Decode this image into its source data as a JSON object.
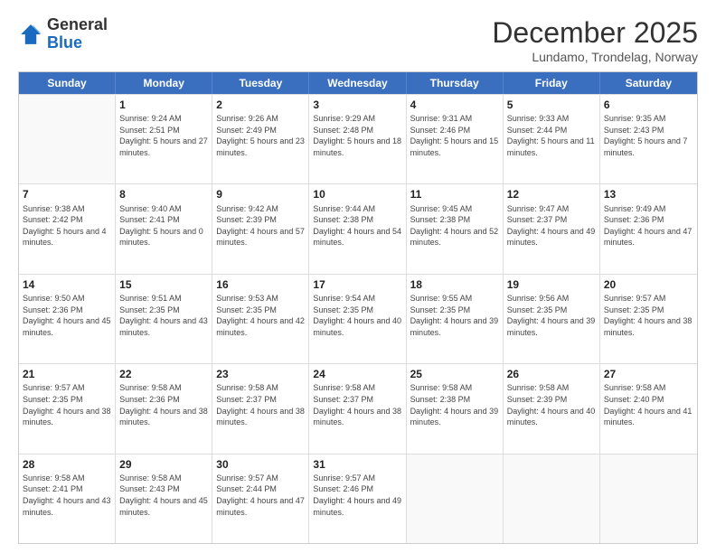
{
  "header": {
    "logo": {
      "line1": "General",
      "line2": "Blue"
    },
    "month": "December 2025",
    "location": "Lundamo, Trondelag, Norway"
  },
  "weekdays": [
    "Sunday",
    "Monday",
    "Tuesday",
    "Wednesday",
    "Thursday",
    "Friday",
    "Saturday"
  ],
  "rows": [
    [
      {
        "day": "",
        "empty": true
      },
      {
        "day": "1",
        "sunrise": "Sunrise: 9:24 AM",
        "sunset": "Sunset: 2:51 PM",
        "daylight": "Daylight: 5 hours and 27 minutes."
      },
      {
        "day": "2",
        "sunrise": "Sunrise: 9:26 AM",
        "sunset": "Sunset: 2:49 PM",
        "daylight": "Daylight: 5 hours and 23 minutes."
      },
      {
        "day": "3",
        "sunrise": "Sunrise: 9:29 AM",
        "sunset": "Sunset: 2:48 PM",
        "daylight": "Daylight: 5 hours and 18 minutes."
      },
      {
        "day": "4",
        "sunrise": "Sunrise: 9:31 AM",
        "sunset": "Sunset: 2:46 PM",
        "daylight": "Daylight: 5 hours and 15 minutes."
      },
      {
        "day": "5",
        "sunrise": "Sunrise: 9:33 AM",
        "sunset": "Sunset: 2:44 PM",
        "daylight": "Daylight: 5 hours and 11 minutes."
      },
      {
        "day": "6",
        "sunrise": "Sunrise: 9:35 AM",
        "sunset": "Sunset: 2:43 PM",
        "daylight": "Daylight: 5 hours and 7 minutes."
      }
    ],
    [
      {
        "day": "7",
        "sunrise": "Sunrise: 9:38 AM",
        "sunset": "Sunset: 2:42 PM",
        "daylight": "Daylight: 5 hours and 4 minutes."
      },
      {
        "day": "8",
        "sunrise": "Sunrise: 9:40 AM",
        "sunset": "Sunset: 2:41 PM",
        "daylight": "Daylight: 5 hours and 0 minutes."
      },
      {
        "day": "9",
        "sunrise": "Sunrise: 9:42 AM",
        "sunset": "Sunset: 2:39 PM",
        "daylight": "Daylight: 4 hours and 57 minutes."
      },
      {
        "day": "10",
        "sunrise": "Sunrise: 9:44 AM",
        "sunset": "Sunset: 2:38 PM",
        "daylight": "Daylight: 4 hours and 54 minutes."
      },
      {
        "day": "11",
        "sunrise": "Sunrise: 9:45 AM",
        "sunset": "Sunset: 2:38 PM",
        "daylight": "Daylight: 4 hours and 52 minutes."
      },
      {
        "day": "12",
        "sunrise": "Sunrise: 9:47 AM",
        "sunset": "Sunset: 2:37 PM",
        "daylight": "Daylight: 4 hours and 49 minutes."
      },
      {
        "day": "13",
        "sunrise": "Sunrise: 9:49 AM",
        "sunset": "Sunset: 2:36 PM",
        "daylight": "Daylight: 4 hours and 47 minutes."
      }
    ],
    [
      {
        "day": "14",
        "sunrise": "Sunrise: 9:50 AM",
        "sunset": "Sunset: 2:36 PM",
        "daylight": "Daylight: 4 hours and 45 minutes."
      },
      {
        "day": "15",
        "sunrise": "Sunrise: 9:51 AM",
        "sunset": "Sunset: 2:35 PM",
        "daylight": "Daylight: 4 hours and 43 minutes."
      },
      {
        "day": "16",
        "sunrise": "Sunrise: 9:53 AM",
        "sunset": "Sunset: 2:35 PM",
        "daylight": "Daylight: 4 hours and 42 minutes."
      },
      {
        "day": "17",
        "sunrise": "Sunrise: 9:54 AM",
        "sunset": "Sunset: 2:35 PM",
        "daylight": "Daylight: 4 hours and 40 minutes."
      },
      {
        "day": "18",
        "sunrise": "Sunrise: 9:55 AM",
        "sunset": "Sunset: 2:35 PM",
        "daylight": "Daylight: 4 hours and 39 minutes."
      },
      {
        "day": "19",
        "sunrise": "Sunrise: 9:56 AM",
        "sunset": "Sunset: 2:35 PM",
        "daylight": "Daylight: 4 hours and 39 minutes."
      },
      {
        "day": "20",
        "sunrise": "Sunrise: 9:57 AM",
        "sunset": "Sunset: 2:35 PM",
        "daylight": "Daylight: 4 hours and 38 minutes."
      }
    ],
    [
      {
        "day": "21",
        "sunrise": "Sunrise: 9:57 AM",
        "sunset": "Sunset: 2:35 PM",
        "daylight": "Daylight: 4 hours and 38 minutes."
      },
      {
        "day": "22",
        "sunrise": "Sunrise: 9:58 AM",
        "sunset": "Sunset: 2:36 PM",
        "daylight": "Daylight: 4 hours and 38 minutes."
      },
      {
        "day": "23",
        "sunrise": "Sunrise: 9:58 AM",
        "sunset": "Sunset: 2:37 PM",
        "daylight": "Daylight: 4 hours and 38 minutes."
      },
      {
        "day": "24",
        "sunrise": "Sunrise: 9:58 AM",
        "sunset": "Sunset: 2:37 PM",
        "daylight": "Daylight: 4 hours and 38 minutes."
      },
      {
        "day": "25",
        "sunrise": "Sunrise: 9:58 AM",
        "sunset": "Sunset: 2:38 PM",
        "daylight": "Daylight: 4 hours and 39 minutes."
      },
      {
        "day": "26",
        "sunrise": "Sunrise: 9:58 AM",
        "sunset": "Sunset: 2:39 PM",
        "daylight": "Daylight: 4 hours and 40 minutes."
      },
      {
        "day": "27",
        "sunrise": "Sunrise: 9:58 AM",
        "sunset": "Sunset: 2:40 PM",
        "daylight": "Daylight: 4 hours and 41 minutes."
      }
    ],
    [
      {
        "day": "28",
        "sunrise": "Sunrise: 9:58 AM",
        "sunset": "Sunset: 2:41 PM",
        "daylight": "Daylight: 4 hours and 43 minutes."
      },
      {
        "day": "29",
        "sunrise": "Sunrise: 9:58 AM",
        "sunset": "Sunset: 2:43 PM",
        "daylight": "Daylight: 4 hours and 45 minutes."
      },
      {
        "day": "30",
        "sunrise": "Sunrise: 9:57 AM",
        "sunset": "Sunset: 2:44 PM",
        "daylight": "Daylight: 4 hours and 47 minutes."
      },
      {
        "day": "31",
        "sunrise": "Sunrise: 9:57 AM",
        "sunset": "Sunset: 2:46 PM",
        "daylight": "Daylight: 4 hours and 49 minutes."
      },
      {
        "day": "",
        "empty": true
      },
      {
        "day": "",
        "empty": true
      },
      {
        "day": "",
        "empty": true
      }
    ]
  ]
}
